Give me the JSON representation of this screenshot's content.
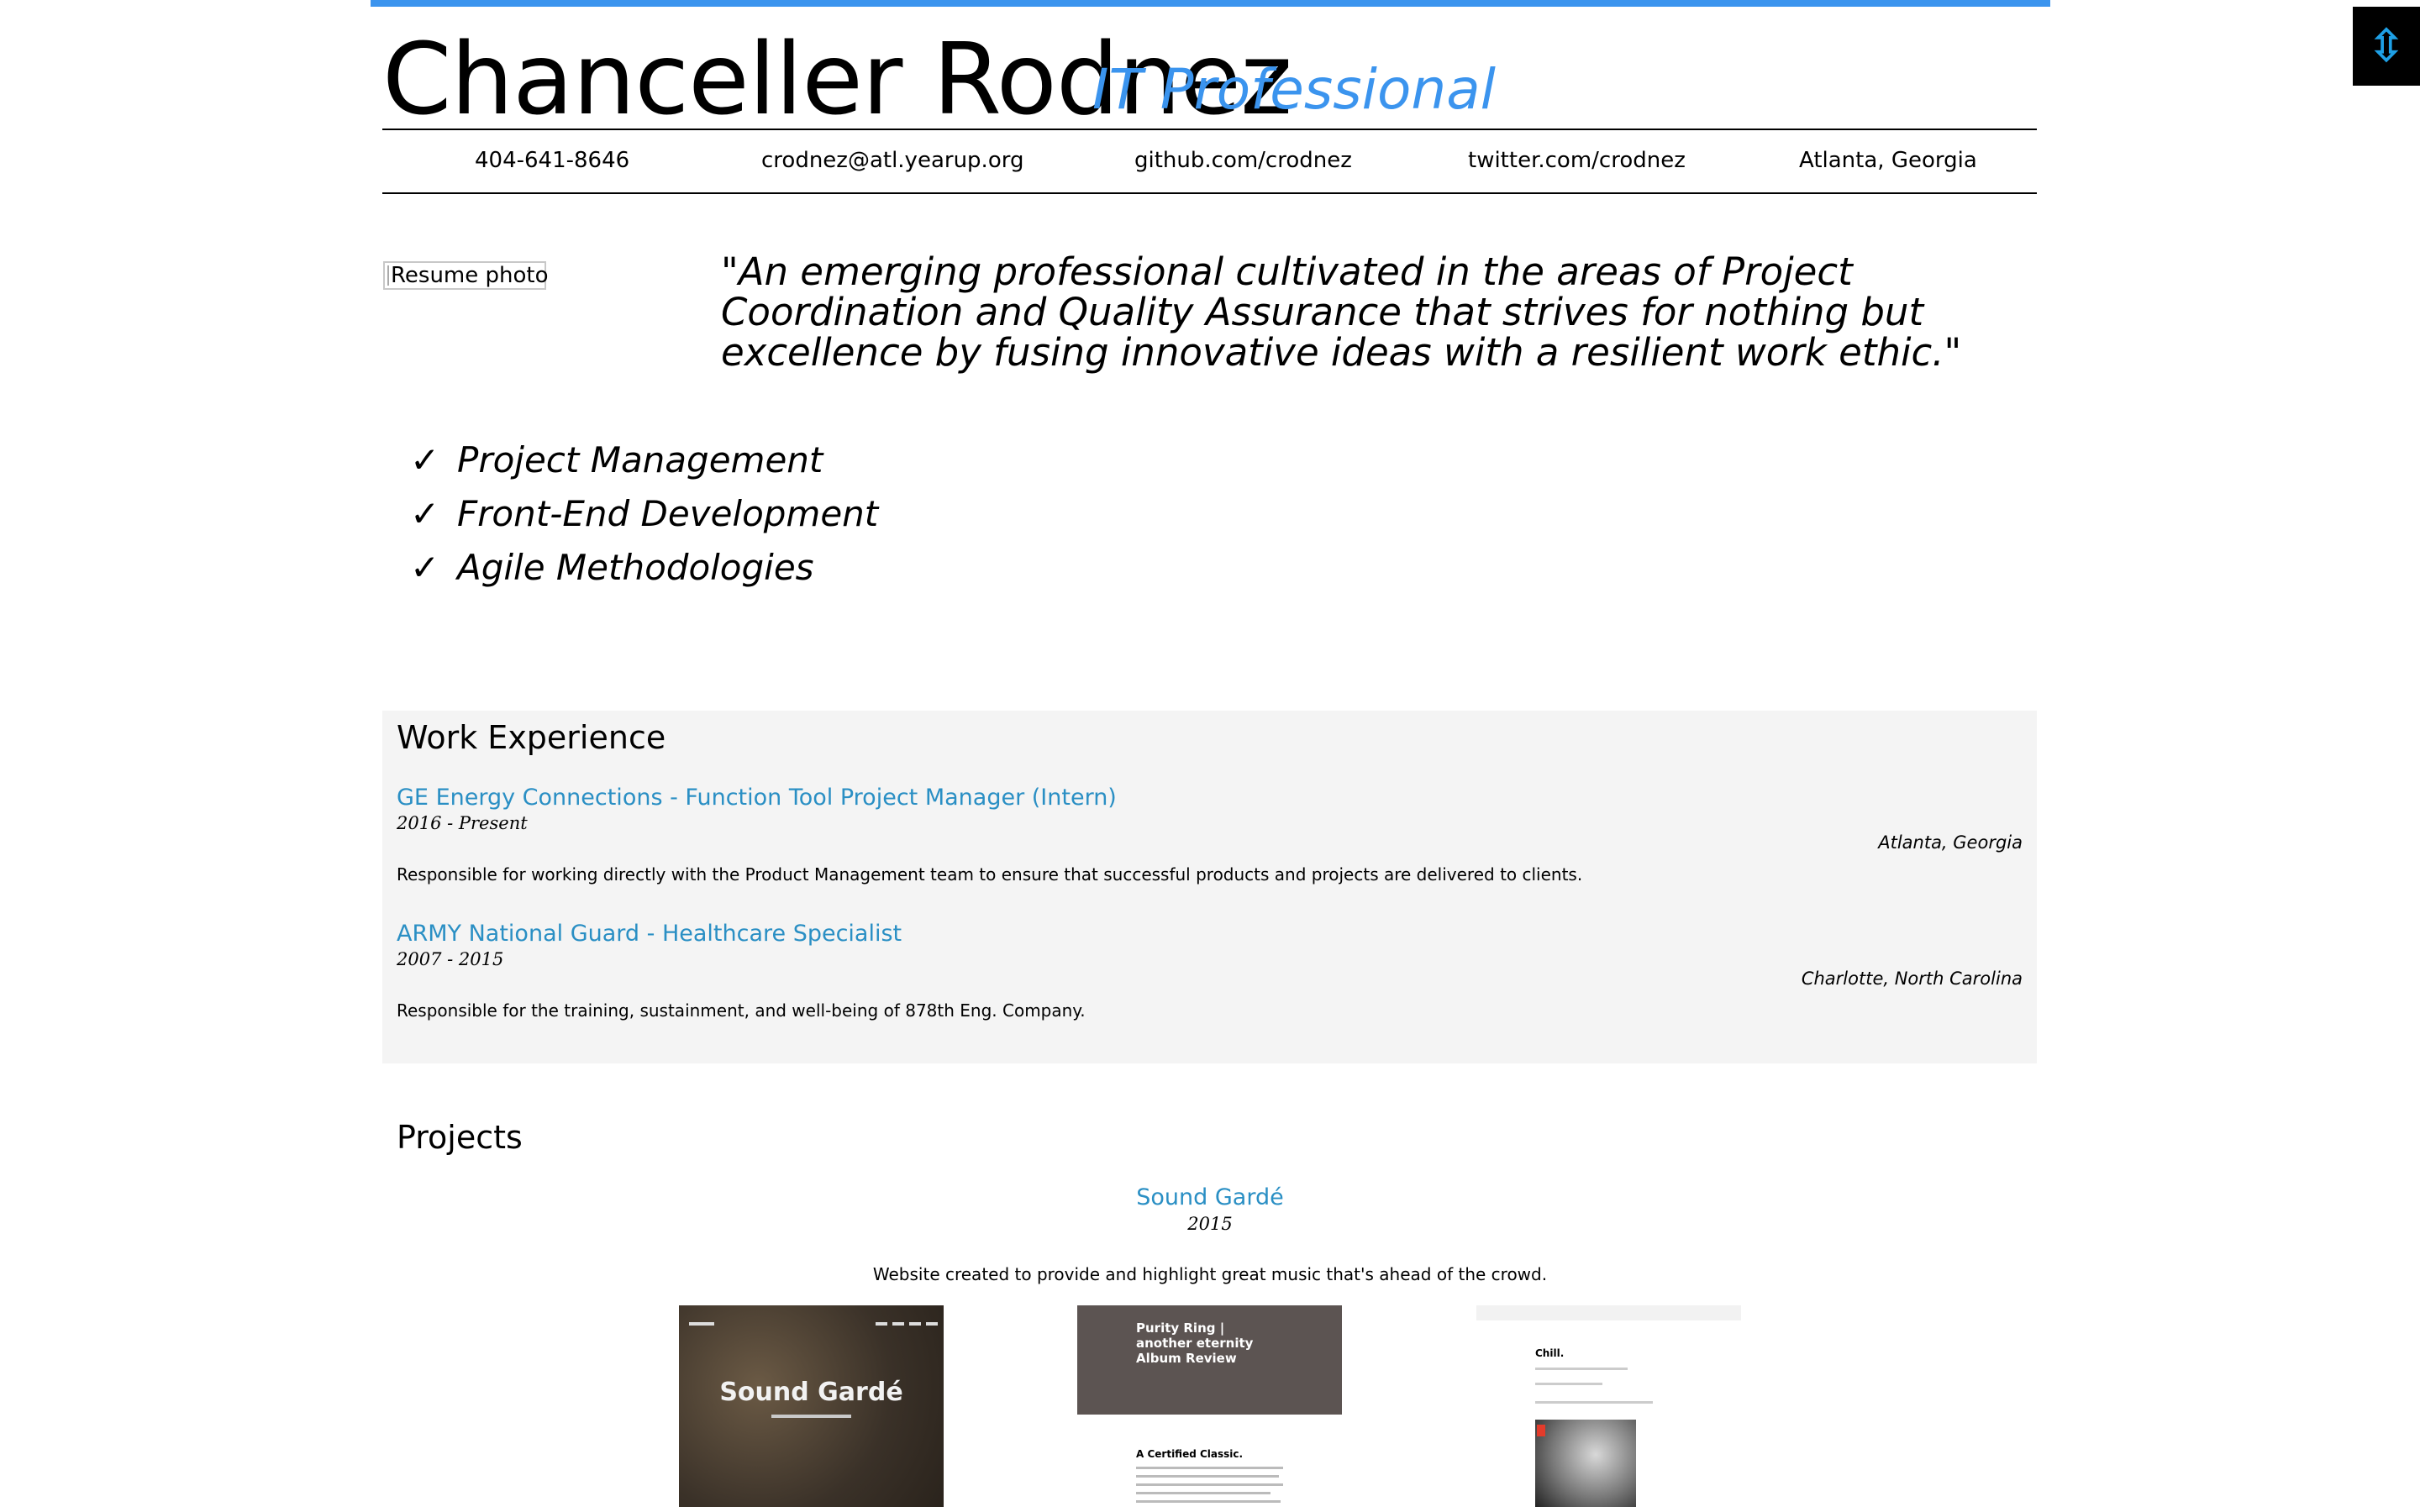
{
  "header": {
    "name": "Chanceller Rodnez",
    "title": "IT Professional",
    "accent_color": "#3b94ee",
    "toggle_icon": "up-down-arrow-icon"
  },
  "contact": {
    "phone": "404-641-8646",
    "email": "crodnez@atl.yearup.org",
    "github": "github.com/crodnez",
    "twitter": "twitter.com/crodnez",
    "location": "Atlanta, Georgia"
  },
  "photo": {
    "alt": "Resume photo"
  },
  "quote": "\"An emerging professional cultivated in the areas of Project Coordination and Quality Assurance that strives for nothing but excellence by fusing innovative ideas with a resilient work ethic.\"",
  "skills": [
    {
      "check": "✓",
      "label": "Project Management"
    },
    {
      "check": "✓",
      "label": "Front-End Development"
    },
    {
      "check": "✓",
      "label": "Agile Methodologies"
    }
  ],
  "work": {
    "heading": "Work Experience",
    "jobs": [
      {
        "title": "GE Energy Connections - Function Tool Project Manager (Intern)",
        "dates": "2016 - Present",
        "location": "Atlanta, Georgia",
        "description": "Responsible for working directly with the Product Management team to ensure that successful products and projects are delivered to clients."
      },
      {
        "title": "ARMY National Guard - Healthcare Specialist",
        "dates": "2007 - 2015",
        "location": "Charlotte, North Carolina",
        "description": "Responsible for the training, sustainment, and well-being of 878th Eng. Company."
      }
    ]
  },
  "projects": {
    "heading": "Projects",
    "items": [
      {
        "title": "Sound Gardé",
        "year": "2015",
        "description": "Website created to provide and highlight great music that's ahead of the crowd.",
        "screenshots": [
          {
            "logo": "Sound Gardé"
          },
          {
            "hero_title": "Purity Ring | another eternity Album Review",
            "heading": "A Certified Classic."
          },
          {
            "heading": "Chill."
          }
        ]
      }
    ]
  }
}
